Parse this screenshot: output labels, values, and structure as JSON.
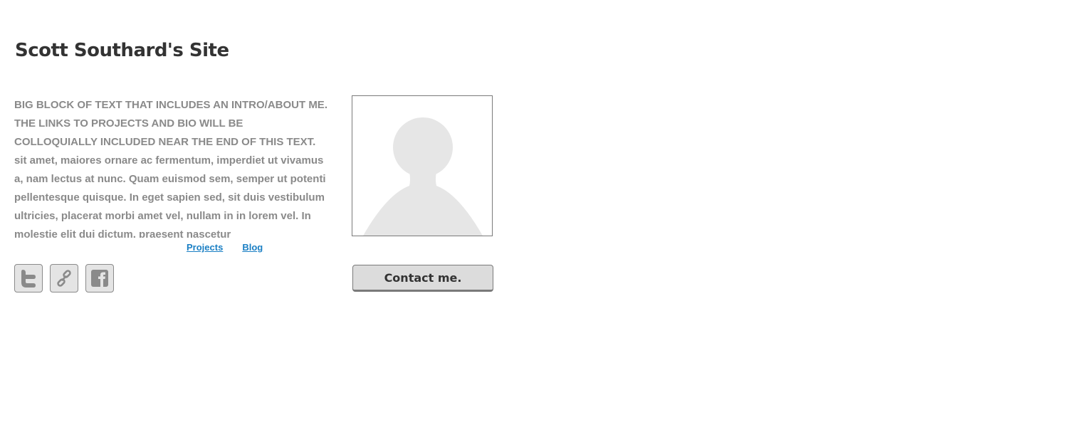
{
  "site": {
    "title": "Scott Southard's Site"
  },
  "intro": {
    "lead": "BIG BLOCK OF TEXT THAT INCLUDES AN INTRO/ABOUT ME. THE LINKS TO PROJECTS AND BIO WILL BE COLLOQUIALLY INCLUDED NEAR THE END OF THIS TEXT.",
    "body": " sit amet, maiores ornare ac fermentum, imperdiet ut vivamus a, nam lectus at nunc. Quam euismod sem, semper ut potenti pellentesque quisque. In eget sapien sed, sit duis vestibulum ultricies, placerat morbi amet vel, nullam in in lorem vel. In molestie elit dui dictum, praesent nascetur"
  },
  "links": [
    {
      "label": "Projects"
    },
    {
      "label": "Blog"
    }
  ],
  "social": [
    {
      "icon": "twitter-icon"
    },
    {
      "icon": "link-icon"
    },
    {
      "icon": "facebook-icon"
    }
  ],
  "contact": {
    "label": "Contact me."
  },
  "colors": {
    "title": "#333333",
    "body_text": "#8a8a8a",
    "link": "#1a7fc4",
    "button_bg": "#dcdcdc",
    "border": "#7a7a7a",
    "placeholder": "#e6e6e6"
  }
}
